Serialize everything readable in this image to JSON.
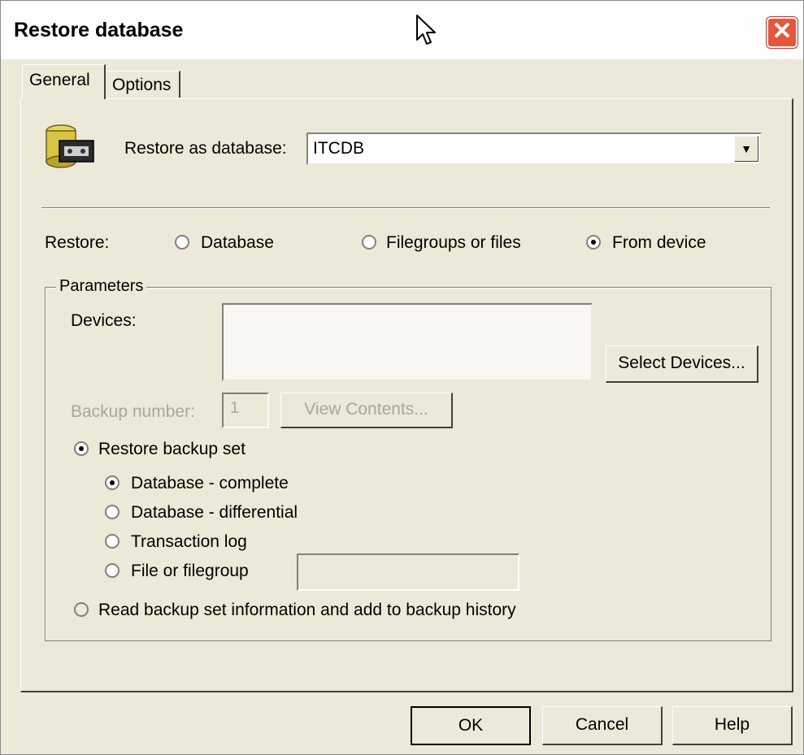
{
  "window": {
    "title": "Restore database"
  },
  "tabs": [
    {
      "label": "General",
      "active": true
    },
    {
      "label": "Options",
      "active": false
    }
  ],
  "restore_as": {
    "label": "Restore as database:",
    "value": "ITCDB"
  },
  "restore": {
    "label": "Restore:",
    "options": [
      {
        "label": "Database",
        "selected": false
      },
      {
        "label": "Filegroups or files",
        "selected": false
      },
      {
        "label": "From device",
        "selected": true
      }
    ]
  },
  "parameters": {
    "title": "Parameters",
    "devices_label": "Devices:",
    "devices_value": "",
    "select_devices_button": "Select Devices...",
    "backup_number_label": "Backup number:",
    "backup_number_value": "1",
    "view_contents_button": "View Contents...",
    "restore_backup_set": {
      "label": "Restore backup set",
      "selected": true
    },
    "backup_types": [
      {
        "label": "Database - complete",
        "selected": true
      },
      {
        "label": "Database - differential",
        "selected": false
      },
      {
        "label": "Transaction log",
        "selected": false
      },
      {
        "label": "File or filegroup",
        "selected": false
      }
    ],
    "file_or_filegroup_value": "",
    "read_backup_info": {
      "label": "Read backup set information and add to backup history",
      "selected": false
    }
  },
  "buttons": {
    "ok": "OK",
    "cancel": "Cancel",
    "help": "Help"
  },
  "icons": {
    "close": "close-icon",
    "cursor": "mouse-pointer-icon",
    "database": "database-device-icon"
  },
  "colors": {
    "dialog_bg": "#ece9d8",
    "close_button": "#e5563d",
    "disabled_text": "#a9a795"
  }
}
